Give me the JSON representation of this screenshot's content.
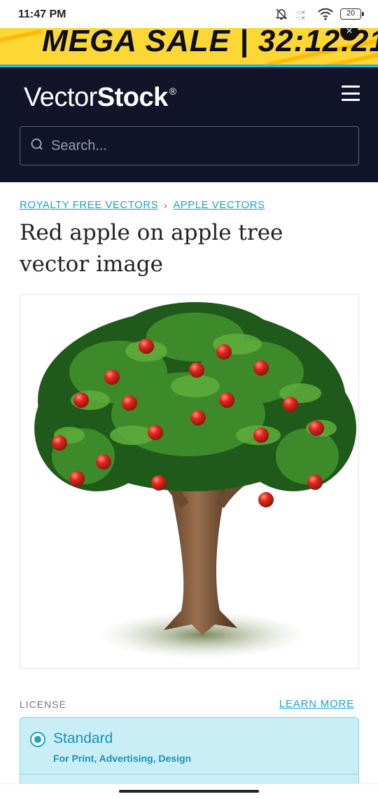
{
  "status_bar": {
    "time": "11:47 PM",
    "battery": "20"
  },
  "banner": {
    "text": "MEGA SALE | 32:12:21",
    "close_symbol": "×"
  },
  "header": {
    "logo_thin": "Vector",
    "logo_bold": "Stock",
    "logo_mark": "®",
    "search_placeholder": "Search..."
  },
  "breadcrumb": {
    "items": [
      "ROYALTY FREE VECTORS",
      "APPLE VECTORS"
    ],
    "separator": "›"
  },
  "page": {
    "title": "Red apple on apple tree vector image"
  },
  "license": {
    "label": "LICENSE",
    "learn_more": "LEARN MORE",
    "selected": {
      "name": "Standard",
      "description": "For Print, Advertising, Design"
    }
  },
  "colors": {
    "header_bg": "#12142a",
    "banner_bg": "#fdd835",
    "accent": "#1ba3c6",
    "license_bg": "#c9eef6"
  },
  "icons": [
    "search-icon",
    "menu-icon",
    "bell-off-icon",
    "wifi-icon",
    "battery-icon",
    "close-icon",
    "radio-selected-icon"
  ]
}
